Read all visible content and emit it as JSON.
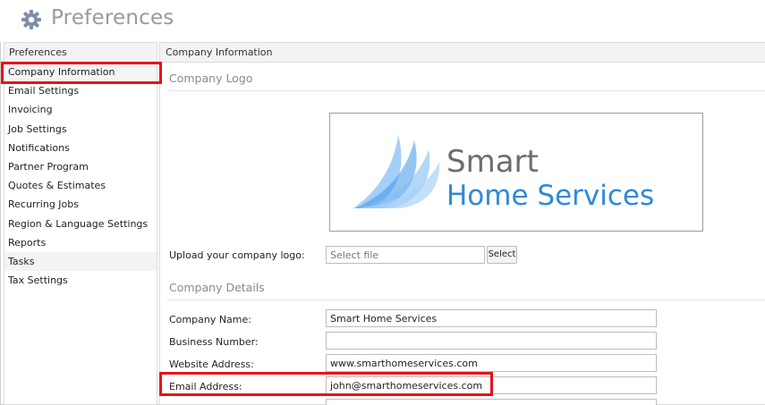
{
  "header": {
    "title": "Preferences"
  },
  "sidebar": {
    "heading": "Preferences",
    "items": [
      {
        "label": "Company Information"
      },
      {
        "label": "Email Settings"
      },
      {
        "label": "Invoicing"
      },
      {
        "label": "Job Settings"
      },
      {
        "label": "Notifications"
      },
      {
        "label": "Partner Program"
      },
      {
        "label": "Quotes & Estimates"
      },
      {
        "label": "Recurring Jobs"
      },
      {
        "label": "Region & Language Settings"
      },
      {
        "label": "Reports"
      },
      {
        "label": "Tasks"
      },
      {
        "label": "Tax Settings"
      }
    ]
  },
  "main": {
    "heading": "Company Information",
    "logo_section": {
      "title": "Company Logo",
      "logo_text_line1": "Smart",
      "logo_text_line2": "Home Services",
      "upload_label": "Upload your company logo:",
      "upload_placeholder": "Select file",
      "select_button": "Select"
    },
    "details_section": {
      "title": "Company Details",
      "fields": [
        {
          "label": "Company Name:",
          "value": "Smart Home Services"
        },
        {
          "label": "Business Number:",
          "value": ""
        },
        {
          "label": "Website Address:",
          "value": "www.smarthomeservices.com"
        },
        {
          "label": "Email Address:",
          "value": "john@smarthomeservices.com"
        }
      ]
    }
  },
  "colors": {
    "highlight": "#e8121a",
    "logo_blue": "#2e8ad8",
    "logo_gray": "#6d6d6d",
    "title_gray": "#9a9a9a"
  },
  "icons": {
    "header_icon": "gear-icon"
  }
}
